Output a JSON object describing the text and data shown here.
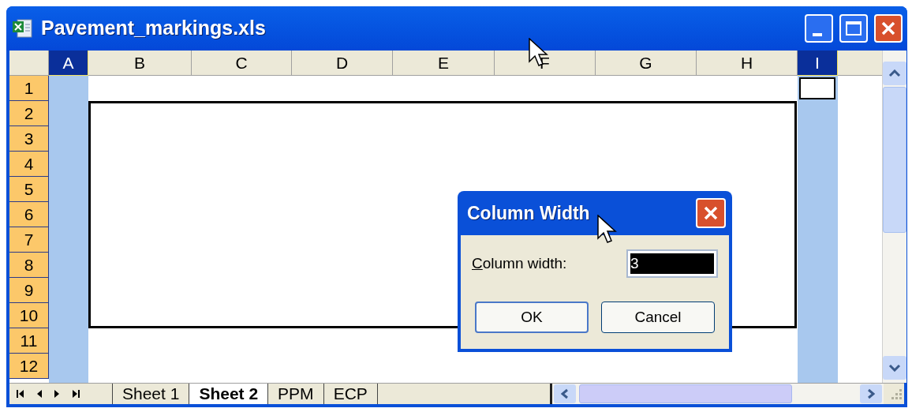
{
  "window": {
    "title": "Pavement_markings.xls"
  },
  "columns": [
    {
      "label": "A",
      "selected": true
    },
    {
      "label": "B",
      "selected": false
    },
    {
      "label": "C",
      "selected": false
    },
    {
      "label": "D",
      "selected": false
    },
    {
      "label": "E",
      "selected": false
    },
    {
      "label": "F",
      "selected": false
    },
    {
      "label": "G",
      "selected": false
    },
    {
      "label": "H",
      "selected": false
    },
    {
      "label": "I",
      "selected": true
    }
  ],
  "rows": [
    "1",
    "2",
    "3",
    "4",
    "5",
    "6",
    "7",
    "8",
    "9",
    "10",
    "11",
    "12"
  ],
  "sheet_tabs": [
    {
      "label": "Sheet 1",
      "selected": false
    },
    {
      "label": "Sheet 2",
      "selected": true
    },
    {
      "label": "PPM",
      "selected": false
    },
    {
      "label": "ECP",
      "selected": false
    }
  ],
  "dialog": {
    "title": "Column Width",
    "field_label": "Column width:",
    "value": "3",
    "value_selected": true,
    "buttons": [
      {
        "label": "OK",
        "default": true
      },
      {
        "label": "Cancel",
        "default": false
      }
    ]
  }
}
